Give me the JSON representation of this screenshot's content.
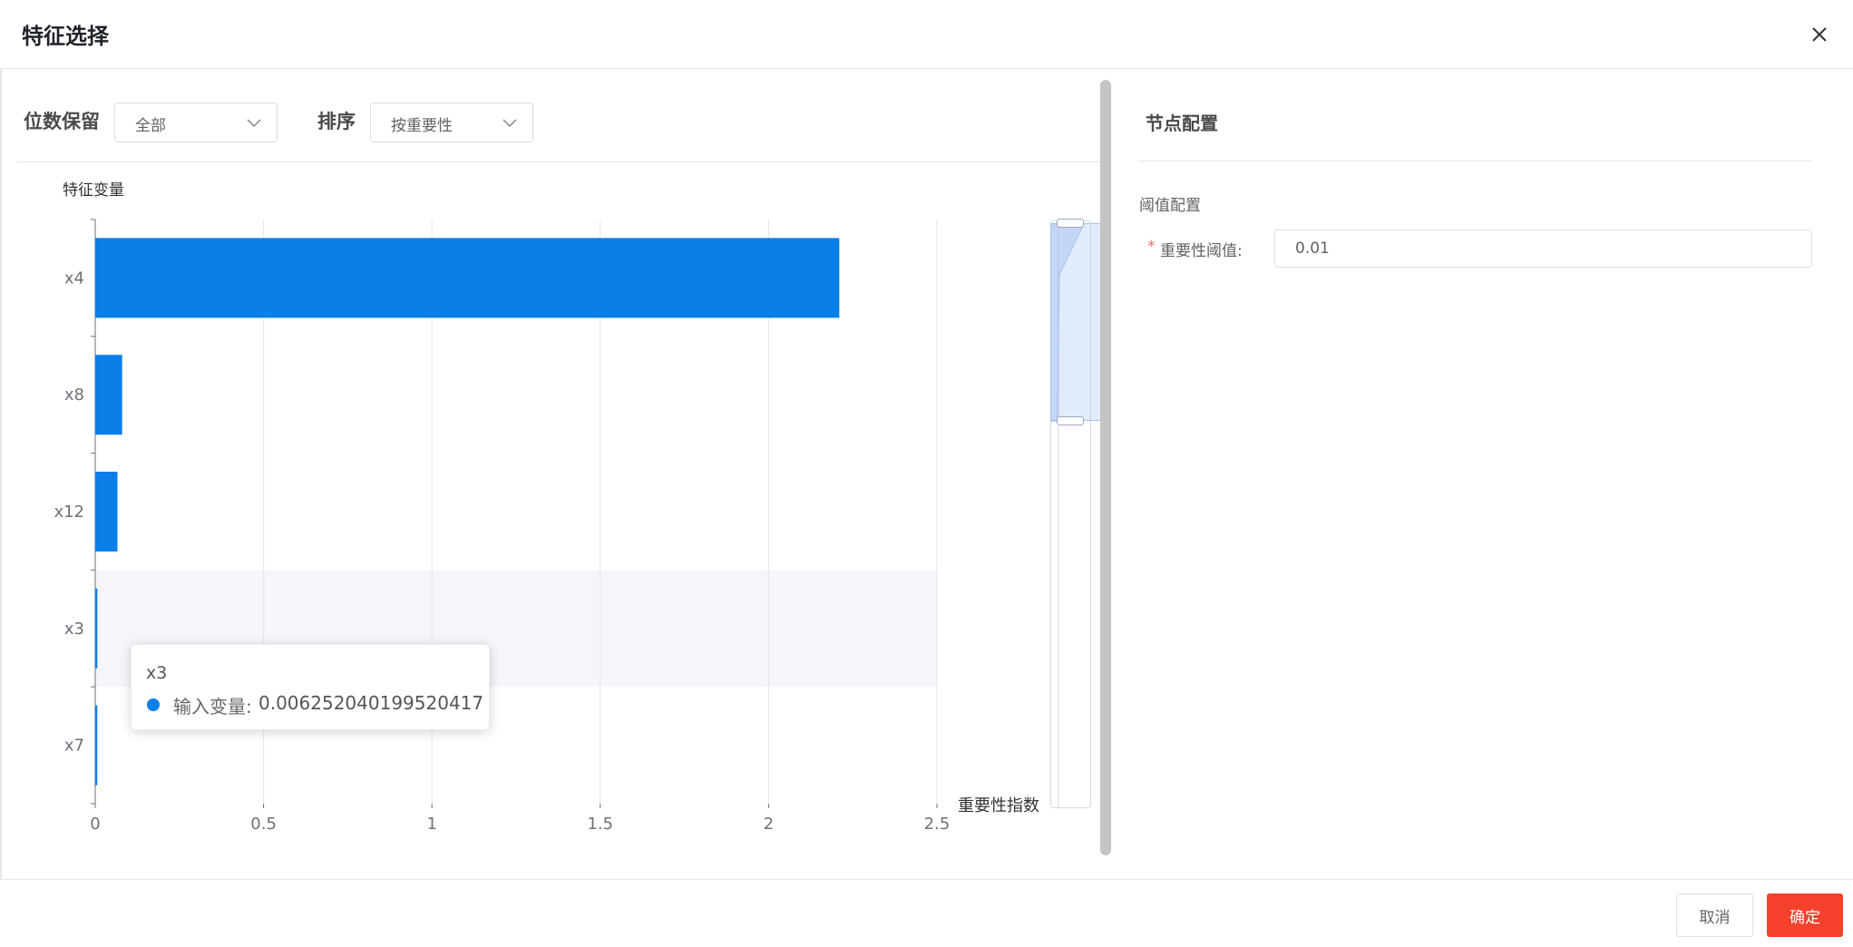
{
  "dialog": {
    "title": "特征选择"
  },
  "toolbar": {
    "precision_label": "位数保留",
    "precision_value": "全部",
    "sort_label": "排序",
    "sort_value": "按重要性"
  },
  "chart_data": {
    "type": "bar",
    "orientation": "horizontal",
    "categories": [
      "x4",
      "x8",
      "x12",
      "x3",
      "x7"
    ],
    "values": [
      2.21,
      0.08,
      0.066,
      0.006252040199520417,
      0.006
    ],
    "xlabel": "重要性指数",
    "ylabel": "特征变量",
    "xlim": [
      0,
      2.5
    ],
    "x_ticks": [
      "0",
      "0.5",
      "1",
      "1.5",
      "2",
      "2.5"
    ],
    "grid": true,
    "bar_color": "#0a7fe8",
    "highlighted_category": "x3"
  },
  "tooltip": {
    "title": "x3",
    "series_name": "输入变量:",
    "value": "0.006252040199520417"
  },
  "right_panel": {
    "title": "节点配置",
    "section_label": "阈值配置",
    "required_mark": "*",
    "field_label": "重要性阈值:",
    "field_value": "0.01"
  },
  "footer": {
    "cancel_label": "取消",
    "ok_label": "确定"
  },
  "colors": {
    "accent": "#0a7fe8",
    "primary_button": "#f5402c"
  }
}
